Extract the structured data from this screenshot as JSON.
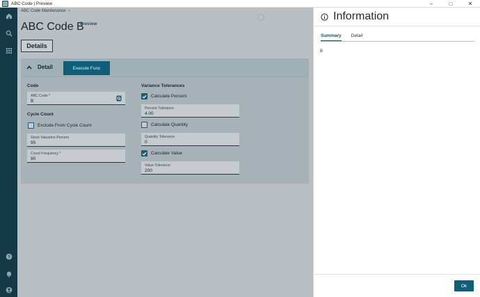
{
  "window": {
    "title": "ABC Code | Preview",
    "minimize": "–",
    "maximize": "□",
    "close": "✕"
  },
  "rail": {
    "top_icons": [
      "home-icon",
      "search-icon",
      "apps-grid-icon"
    ],
    "bottom_icons": [
      "help-icon",
      "notifications-icon",
      "user-icon"
    ]
  },
  "main": {
    "breadcrumb": "ABC Code Maintenance",
    "breadcrumb_sep": "›",
    "title": "ABC Code B",
    "preview_label": "Preview",
    "details_tab": "Details",
    "section": {
      "title": "Detail",
      "execute_button": "Execute Func",
      "code": {
        "label": "Code",
        "abc_code_label": "ABC Code *",
        "abc_code_value": "B"
      },
      "cycle_count": {
        "label": "Cycle Count",
        "exclude_label": "Exclude From Cycle Count",
        "exclude_checked": false,
        "stock_valuation_label": "Stock Valuation Percent",
        "stock_valuation_value": "95",
        "count_frequency_label": "Count Frequency *",
        "count_frequency_value": "90"
      },
      "variance": {
        "label": "Variance Tolerances",
        "calc_percent_label": "Calculate Percent",
        "calc_percent_checked": true,
        "percent_tol_label": "Percent Tolerance",
        "percent_tol_value": "4.00",
        "calc_quantity_label": "Calculate Quantity",
        "calc_quantity_checked": false,
        "quantity_tol_label": "Quantity Tolerance",
        "quantity_tol_value": "0",
        "calc_value_label": "Calculate Value",
        "calc_value_checked": true,
        "value_tol_label": "Value Tolerance",
        "value_tol_value": "200"
      }
    }
  },
  "panel": {
    "title": "Information",
    "tabs": [
      {
        "label": "Summary",
        "active": true
      },
      {
        "label": "Detail",
        "active": false
      }
    ],
    "value": "B",
    "ok_button": "Ok"
  },
  "colors": {
    "rail": "#153a47",
    "accent": "#0f5f7a",
    "overlay": "#b9bfc3"
  }
}
